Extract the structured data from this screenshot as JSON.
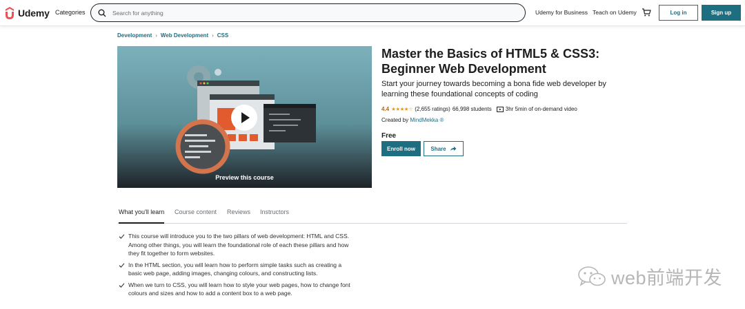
{
  "header": {
    "logo_text": "Udemy",
    "categories_label": "Categories",
    "search_placeholder": "Search for anything",
    "business_label": "Udemy for Business",
    "teach_label": "Teach on Udemy",
    "login_label": "Log in",
    "signup_label": "Sign up"
  },
  "breadcrumb": [
    "Development",
    "Web Development",
    "CSS"
  ],
  "preview": {
    "label": "Preview this course"
  },
  "course": {
    "title_line1": "Master the Basics of HTML5 & CSS3:",
    "title_line2": "Beginner Web Development",
    "subtitle": "Start your journey towards becoming a bona fide web developer by learning these foundational concepts of coding",
    "rating": "4.4",
    "stars": "★★★★☆",
    "ratings_count": "(2,655 ratings)",
    "students": "66,998 students",
    "duration": "3hr 5min of on-demand video",
    "created_by_label": "Created by",
    "author": "MindMekka ®",
    "price": "Free",
    "enroll_label": "Enroll now",
    "share_label": "Share"
  },
  "tabs": [
    {
      "label": "What you'll learn",
      "active": true
    },
    {
      "label": "Course content",
      "active": false
    },
    {
      "label": "Reviews",
      "active": false
    },
    {
      "label": "Instructors",
      "active": false
    }
  ],
  "learn_items": [
    "This course will introduce you to the two pillars of web development: HTML and CSS. Among other things, you will learn the foundational role of each these pillars and how they fit together to form websites.",
    "In the HTML section, you will learn how to perform simple tasks such as creating a basic web page, adding images, changing colours, and constructing lists.",
    "When we turn to CSS, you will learn how to style your web pages, how to change font colours and sizes and how to add a content box to a web page."
  ],
  "watermark": {
    "text": "web前端开发"
  },
  "colors": {
    "brand_teal": "#1c6e80",
    "rating_orange": "#b4690e",
    "star_color": "#e59819",
    "logo_red": "#a435f0"
  }
}
